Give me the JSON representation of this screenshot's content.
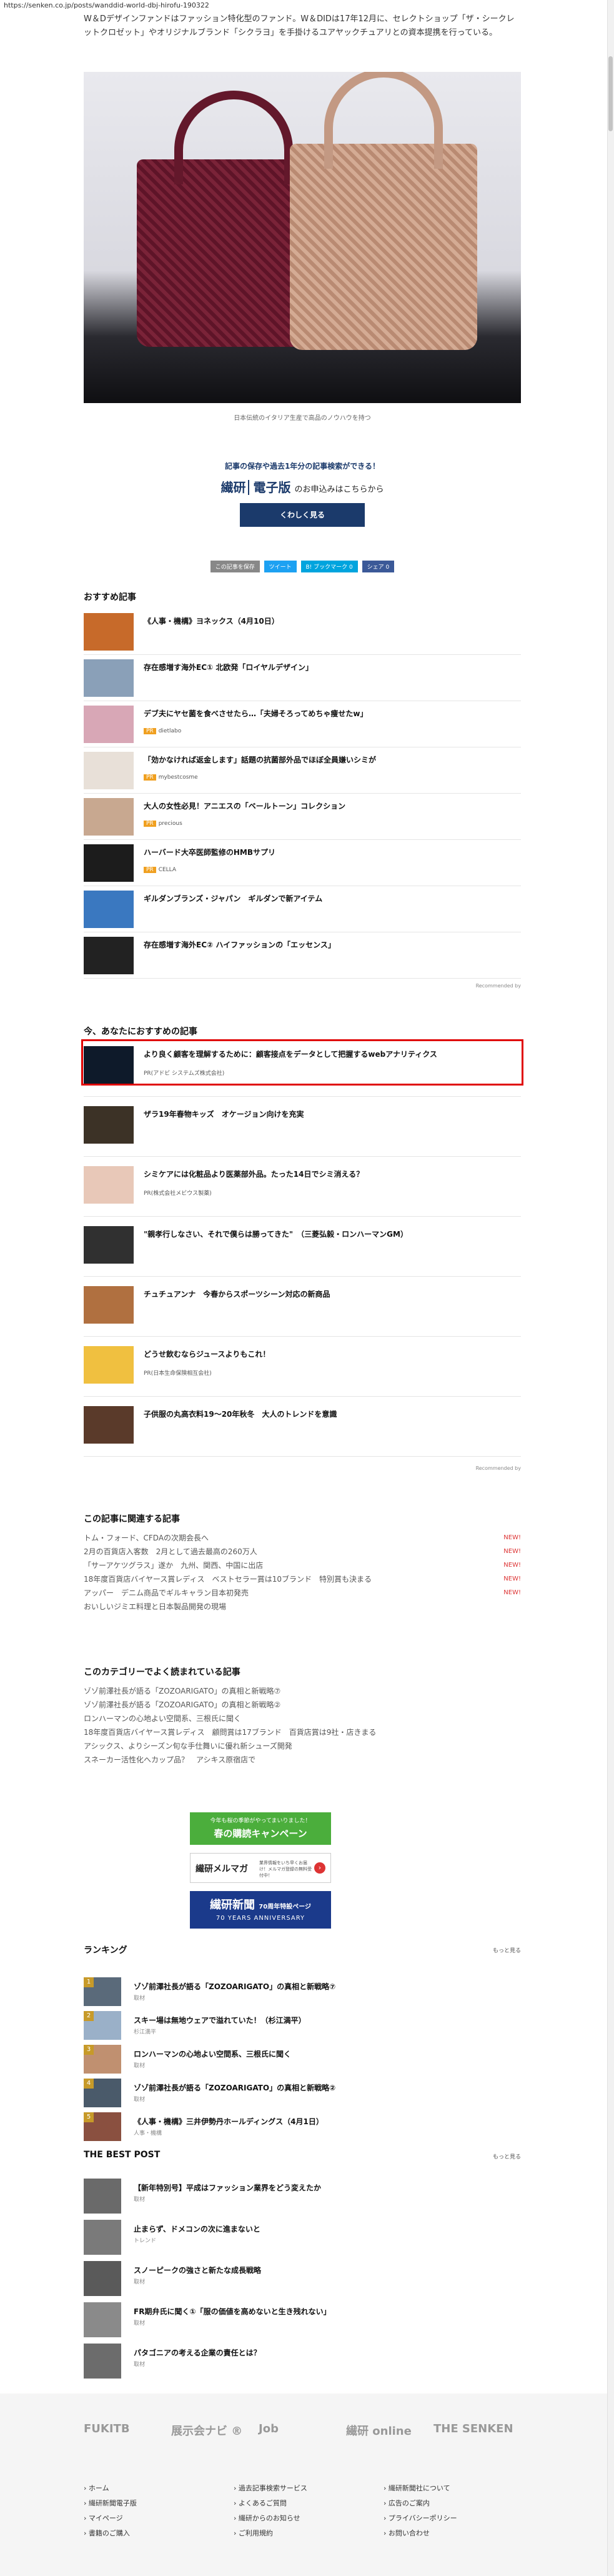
{
  "url": "https://senken.co.jp/posts/wanddid-world-dbj-hirofu-190322",
  "intro": "W＆Dデザインファンドはファッション特化型のファンド。W＆DIDは17年12月に、セレクトショップ「ザ・シークレットクロゼット」やオリジナルブランド「シクラヨ」を手掛けるユアヤックチュアリとの資本提携を行っている。",
  "hero_caption": "日本伝統のイタリア生産で高品のノウハウを持つ",
  "ad": {
    "line1": "記事の保存や過去1年分の記事検索ができる！",
    "brand": "繊研",
    "edition": "電子版",
    "suffix": "のお申込みはこちらから",
    "button": "くわしく見る"
  },
  "share": {
    "b1": "この記事を保存",
    "b2": "ツイート",
    "b3": "B! ブックマーク 0",
    "b4": "シェア 0"
  },
  "osusume": {
    "heading": "おすすめ記事",
    "items": [
      {
        "title": "《人事・機構》ヨネックス（4月10日）",
        "pr": ""
      },
      {
        "title": "存在感増す海外EC① 北欧発「ロイヤルデザイン」",
        "pr": ""
      },
      {
        "title": "デブ夫にヤセ菌を食べさせたら…「夫婦そろってめちゃ痩せたw」",
        "pr": "dietlabo"
      },
      {
        "title": "「効かなければ返金します」話題の抗菌部外品でほぼ全員嫌いシミが",
        "pr": "mybestcosme"
      },
      {
        "title": "大人の女性必見！アニエスの「ベールトーン」コレクション",
        "pr": "precious"
      },
      {
        "title": "ハーバード大卒医師監修のHMBサプリ",
        "pr": "CELLA"
      },
      {
        "title": "ギルダンブランズ・ジャパン　ギルダンで新アイテム",
        "pr": ""
      },
      {
        "title": "存在感増す海外EC② ハイファッションの「エッセンス」",
        "pr": ""
      }
    ],
    "recommended_by": "Recommended by"
  },
  "ima": {
    "heading": "今、あなたにおすすめの記事",
    "items": [
      {
        "title": "より良く顧客を理解するために：顧客接点をデータとして把握するwebアナリティクス",
        "pr": "PR(アドビ システムズ株式会社)"
      },
      {
        "title": "ザラ19年春物キッズ　オケージョン向けを充実",
        "pr": ""
      },
      {
        "title": "シミケアには化粧品より医薬部外品。たった14日でシミ消える？",
        "pr": "PR(株式会社メビウス製薬)"
      },
      {
        "title": "\"親孝行しなさい、それで僕らは勝ってきた\"　（三菱弘毅・ロンハーマンGM）",
        "pr": ""
      },
      {
        "title": "チュチュアンナ　今春からスポーツシーン対応の新商品",
        "pr": ""
      },
      {
        "title": "どうせ飲むならジュースよりもこれ！",
        "pr": "PR(日本生命保険相互会社)"
      },
      {
        "title": "子供服の丸高衣料19～20年秋冬　大人のトレンドを意識",
        "pr": ""
      }
    ],
    "recommended_by": "Recommended by"
  },
  "related": {
    "heading": "この記事に関連する記事",
    "items": [
      {
        "text": "トム・フォード、CFDAの次期会長へ",
        "badge": "NEW!"
      },
      {
        "text": "2月の百貨店入客数　2月として過去最高の260万人",
        "badge": "NEW!"
      },
      {
        "text": "「サーアケツグラス」遂か　九州、関西、中国に出店",
        "badge": "NEW!"
      },
      {
        "text": "18年度百貨店バイヤース賞レディス　ベストセラー賞は10ブランド　特別賞も決まる",
        "badge": "NEW!"
      },
      {
        "text": "アッパー　デニム商品でギルキャラン目本初発売",
        "badge": "NEW!"
      },
      {
        "text": "おいしいジミエ料理と日本製品開発の現場",
        "badge": ""
      }
    ]
  },
  "category": {
    "heading": "このカテゴリーでよく読まれている記事",
    "items": [
      "ゾゾ前澤社長が語る「ZOZOARIGATO」の真相と新戦略⑦",
      "ゾゾ前澤社長が語る「ZOZOARIGATO」の真相と新戦略②",
      "ロンハーマンの心地よい空間系、三根氏に聞く",
      "18年度百貨店バイヤース賞レディス　顧問賞は17ブランド　百貨店賞は9社・店きまる",
      "アシックス、よりシーズン旬な手仕舞いに優れ新シューズ開発",
      "スネーカー活性化へカップ品？　アシキス原宿店で"
    ]
  },
  "banners": {
    "b1_small": "今年も桜の季節がやってまいりました！",
    "b1_title": "春の購読キャンペーン",
    "b2_title": "繊研メルマガ",
    "b2_desc": "業界情報をいち早くお届け！メルマガ登録の無料受付中！",
    "b3_title": "繊研新聞",
    "b3_sub": "70周年特設ページ",
    "b3_en": "70 YEARS ANNIVERSARY"
  },
  "ranking": {
    "heading": "ランキング",
    "more": "もっと見る",
    "items": [
      {
        "num": "1",
        "title": "ゾゾ前澤社長が語る「ZOZOARIGATO」の真相と新戦略⑦",
        "sub": "取材"
      },
      {
        "num": "2",
        "title": "スキー場は無地ウェアで溢れていた！（杉江満平）",
        "sub": "杉江満平"
      },
      {
        "num": "3",
        "title": "ロンハーマンの心地よい空間系、三根氏に聞く",
        "sub": "取材"
      },
      {
        "num": "4",
        "title": "ゾゾ前澤社長が語る「ZOZOARIGATO」の真相と新戦略②",
        "sub": "取材"
      },
      {
        "num": "5",
        "title": "《人事・機構》三井伊勢丹ホールディングス（4月1日）",
        "sub": "人事・機構"
      }
    ]
  },
  "best": {
    "heading": "THE BEST POST",
    "more": "もっと見る",
    "items": [
      {
        "title": "【新年特別号】平成はファッション業界をどう変えたか",
        "sub": "取材"
      },
      {
        "title": "止まらず、ドメコンの次に進まないと",
        "sub": "トレンド"
      },
      {
        "title": "スノーピークの強さと新たな成長戦略",
        "sub": "取材"
      },
      {
        "title": "FR期弁氏に聞く①「服の価値を高めないと生き残れない」",
        "sub": "取材"
      },
      {
        "title": "パタゴニアの考える企業の責任とは？",
        "sub": "取材"
      }
    ]
  },
  "footer": {
    "logos": [
      "FUKITB",
      "展示会ナビ ®",
      "Job",
      "繊研 online",
      "THE SENKEN"
    ],
    "col1": [
      "ホーム",
      "繊研新聞電子版",
      "マイページ",
      "書籍のご購入"
    ],
    "col2": [
      "過去記事検索サービス",
      "よくあるご質問",
      "繊研からのお知らせ",
      "ご利用規約"
    ],
    "col3": [
      "繊研新聞社について",
      "広告のご案内",
      "プライバシーポリシー",
      "お問い合わせ"
    ]
  }
}
